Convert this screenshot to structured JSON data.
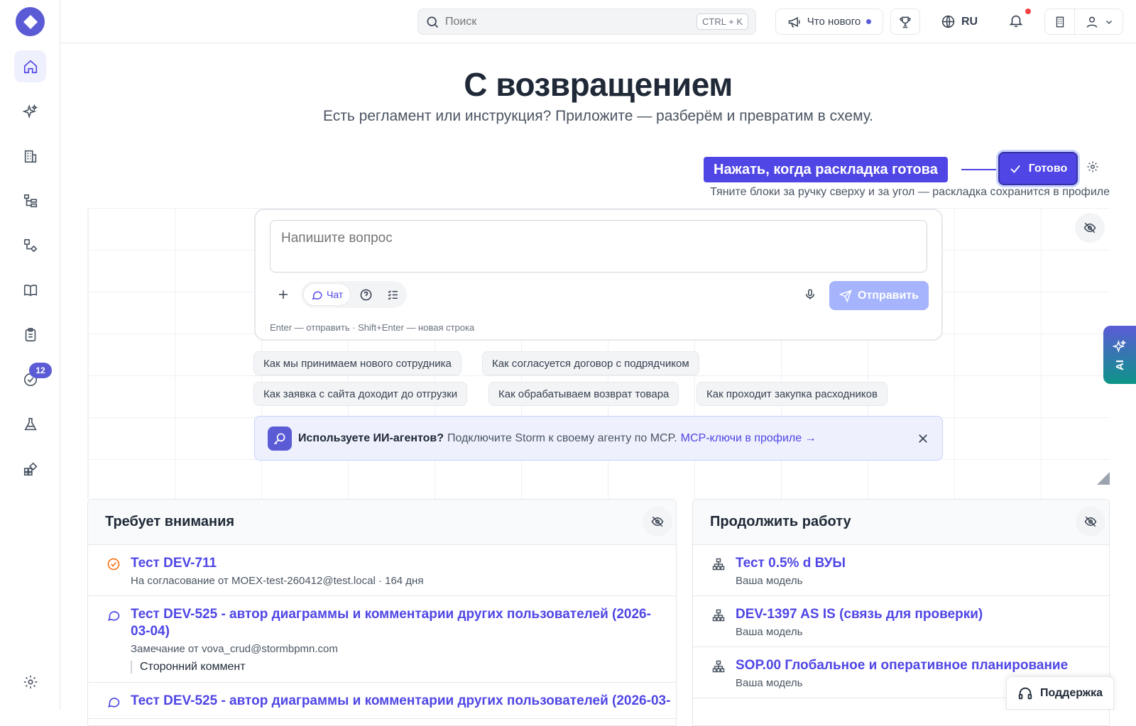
{
  "header": {
    "search_placeholder": "Поиск",
    "search_shortcut": "CTRL + K",
    "whats_new": "Что нового",
    "language": "RU"
  },
  "sidebar": {
    "tasks_badge": "12",
    "items": [
      "home-icon",
      "sparkles-icon",
      "building-icon",
      "hierarchy-icon",
      "flow-icon",
      "book-icon",
      "clipboard-icon",
      "check-badge-icon",
      "flask-icon",
      "apps-icon",
      "gear-icon"
    ]
  },
  "hero": {
    "title": "С возвращением",
    "subtitle": "Есть регламент или инструкция? Приложите — разберём и превратим в схему."
  },
  "layout_edit": {
    "tooltip": "Нажать, когда раскладка готова",
    "done_label": "Готово",
    "hint": "Тяните блоки за ручку сверху и за угол — раскладка сохранится в профиле"
  },
  "ask": {
    "placeholder": "Напишите вопрос",
    "mode_chat": "Чат",
    "send_label": "Отправить",
    "hint": "Enter — отправить · Shift+Enter — новая строка"
  },
  "suggestions": [
    "Как мы принимаем нового сотрудника",
    "Как согласуется договор с подрядчиком",
    "Как заявка с сайта доходит до отгрузки",
    "Как обрабатываем возврат товара",
    "Как проходит закупка расходников"
  ],
  "banner": {
    "bold": "Используете ИИ-агентов?",
    "text": "Подключите Storm к своему агенту по MCP.",
    "link": "MCP-ключи в профиле →"
  },
  "attention": {
    "title": "Требует внимания",
    "items": [
      {
        "icon": "approval-icon",
        "title": "Тест DEV-711",
        "sub": "На согласование от MOEX-test-260412@test.local · 164 дня"
      },
      {
        "icon": "comment-icon",
        "title": "Тест DEV-525 - автор диаграммы и комментарии других пользователей (2026-03-04)",
        "sub": "Замечание от vova_crud@stormbpmn.com",
        "quote": "Сторонний коммент"
      },
      {
        "icon": "comment-icon",
        "title": "Тест DEV-525 - автор диаграммы и комментарии других пользователей (2026-03-"
      }
    ]
  },
  "continue": {
    "title": "Продолжить работу",
    "items": [
      {
        "title": "Тест 0.5% d ВУЫ",
        "sub": "Ваша модель"
      },
      {
        "title": "DEV-1397 AS IS (связь для проверки)",
        "sub": "Ваша модель"
      },
      {
        "title": "SOP.00 Глобальное и оперативное планирование",
        "sub": "Ваша модель"
      }
    ]
  },
  "support_label": "Поддержка",
  "ai_tab_label": "AI",
  "colors": {
    "accent": "#4f46e5",
    "brand": "#5b5bd6",
    "alert": "#ef4444",
    "approval": "#f97316"
  }
}
